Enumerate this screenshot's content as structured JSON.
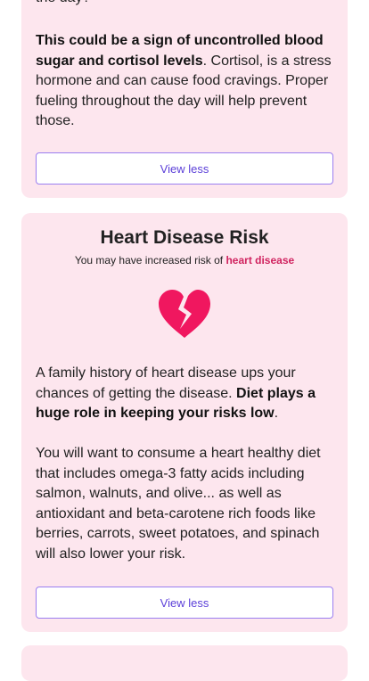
{
  "card_top": {
    "fragment": "the day?",
    "para_bold": "This could be a sign of uncontrolled blood sugar and cortisol levels",
    "para_rest": ". Cortisol, is a stress hormone and can cause food cravings. Proper fueling throughout the day will help prevent those.",
    "button_label": "View less"
  },
  "card_heart": {
    "title": "Heart Disease Risk",
    "subtitle_prefix": "You may have increased risk of ",
    "subtitle_highlight": "heart disease",
    "icon": "broken-heart-icon",
    "icon_color": "#f0175f",
    "p1_text": "A family history of heart disease ups your chances of getting the disease. ",
    "p1_bold": "Diet plays a huge role in keeping your risks low",
    "p1_end": ".",
    "p2_text": "You will want to consume a heart healthy diet that includes omega-3 fatty acids including salmon, walnuts, and olive... as well as antioxidant and beta-carotene rich foods like berries, carrots, sweet potatoes, and spinach will also lower your risk.",
    "button_label": "View less"
  },
  "colors": {
    "card_bg": "#fde6ee",
    "button_border": "#9a7ef0",
    "button_text": "#5b3fd8",
    "highlight": "#d0235f"
  }
}
